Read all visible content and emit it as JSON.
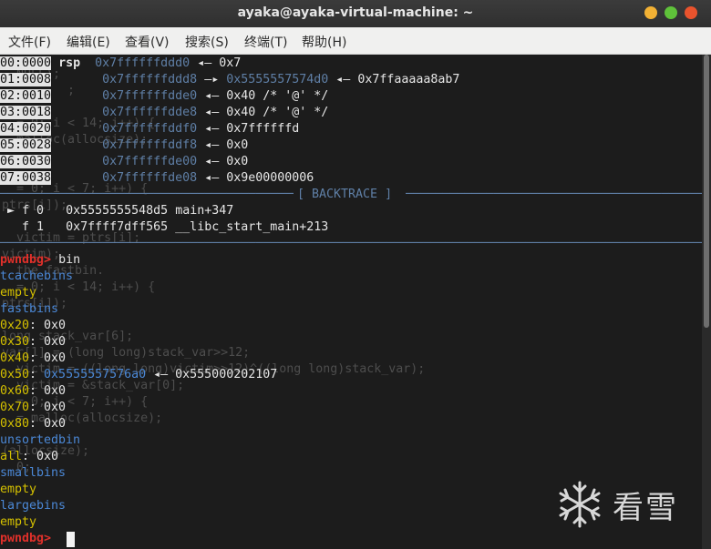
{
  "window": {
    "title": "ayaka@ayaka-virtual-machine: ~",
    "minimize_icon": "minimize-icon",
    "maximize_icon": "maximize-icon",
    "close_icon": "close-icon"
  },
  "menu": [
    {
      "label": "文件(F)"
    },
    {
      "label": "编辑(E)"
    },
    {
      "label": "查看(V)"
    },
    {
      "label": "搜索(S)"
    },
    {
      "label": "终端(T)"
    },
    {
      "label": "帮助(H)"
    }
  ],
  "stack": [
    {
      "idx": "00:0000",
      "reg": "rsp",
      "addr": "0x7ffffffddd0",
      "arrow": "◂—",
      "value": "0x7",
      "value2": ""
    },
    {
      "idx": "01:0008",
      "reg": "",
      "addr": "0x7ffffffddd8",
      "arrow": "—▸",
      "value": "0x5555557574d0",
      "value2": "0x7ffaaaaa8ab7"
    },
    {
      "idx": "02:0010",
      "reg": "",
      "addr": "0x7ffffffdde0",
      "arrow": "◂—",
      "value": "0x40 /* '@' */",
      "value2": ""
    },
    {
      "idx": "03:0018",
      "reg": "",
      "addr": "0x7ffffffdde8",
      "arrow": "◂—",
      "value": "0x40 /* '@' */",
      "value2": ""
    },
    {
      "idx": "04:0020",
      "reg": "",
      "addr": "0x7ffffffddf0",
      "arrow": "◂—",
      "value": "0x7ffffffd",
      "value2": ""
    },
    {
      "idx": "05:0028",
      "reg": "",
      "addr": "0x7ffffffddf8",
      "arrow": "◂—",
      "value": "0x0",
      "value2": ""
    },
    {
      "idx": "06:0030",
      "reg": "",
      "addr": "0x7ffffffde00",
      "arrow": "◂—",
      "value": "0x0",
      "value2": ""
    },
    {
      "idx": "07:0038",
      "reg": "",
      "addr": "0x7ffffffde08",
      "arrow": "◂—",
      "value": "0x9e00000006",
      "value2": ""
    }
  ],
  "backtrace": {
    "header": "[ BACKTRACE ]",
    "frames": [
      {
        "marker": "►",
        "frame": "f 0",
        "addr": "0x5555555548d5",
        "sym": "main+347"
      },
      {
        "marker": "",
        "frame": "f 1",
        "addr": "0x7ffff7dff565",
        "sym": "__libc_start_main+213"
      }
    ]
  },
  "prompt": "pwndbg>",
  "command": "bin",
  "bins": {
    "tcache_label": "tcachebins",
    "tcache_value": "empty",
    "fast_label": "fastbins",
    "fast": [
      {
        "size": "0x20",
        "val": "0x0",
        "chain": "",
        "next": ""
      },
      {
        "size": "0x30",
        "val": "0x0",
        "chain": "",
        "next": ""
      },
      {
        "size": "0x40",
        "val": "0x0",
        "chain": "",
        "next": ""
      },
      {
        "size": "0x50",
        "val": "",
        "chain": "0x5555557576a0",
        "next": "0x555000202107"
      },
      {
        "size": "0x60",
        "val": "0x0",
        "chain": "",
        "next": ""
      },
      {
        "size": "0x70",
        "val": "0x0",
        "chain": "",
        "next": ""
      },
      {
        "size": "0x80",
        "val": "0x0",
        "chain": "",
        "next": ""
      }
    ],
    "unsorted_label": "unsortedbin",
    "unsorted_all": "all",
    "unsorted_value": "0x0",
    "small_label": "smallbins",
    "small_value": "empty",
    "large_label": "largebins",
    "large_value": "empty"
  },
  "ghost_source": [
    "  NULL);",
    "         ;",
    "  = 0; i < 14; i++) {",
    "  malloc(allocsize);",
    "",
    "  = 0; i < 7; i++) {",
    "ptrs[i]);",
    "  victim = ptrs[i];",
    "victim);",
    "  the fastbin.",
    "  = 0; i < 14; i++) {",
    "ptrs[i]);",
    "",
    "long stack_var[6];",
    "var[1] = (long long)stack_var>>12;",
    "  victim = ((long long)victim>>12)^((long long)stack_var);",
    "  victim = &stack_var[0];",
    "  = 0; i < 7; i++) {",
    "  = malloc(allocsize);",
    "",
    "(allocsize);",
    "  0;"
  ],
  "watermark": {
    "text": "看雪",
    "icon": "snowflake-icon"
  }
}
